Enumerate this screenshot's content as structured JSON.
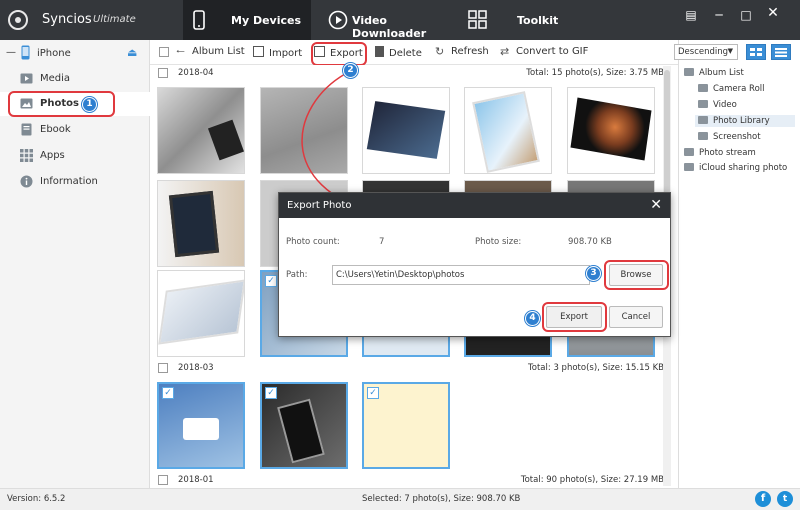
{
  "app": {
    "name": "Syncios",
    "edition": "Ultimate"
  },
  "nav": {
    "tabs": [
      {
        "label": "My Devices"
      },
      {
        "label": "Video Downloader"
      },
      {
        "label": "Toolkit"
      }
    ]
  },
  "device": {
    "name": "iPhone"
  },
  "sidebar": {
    "items": [
      {
        "label": "Media"
      },
      {
        "label": "Photos"
      },
      {
        "label": "Ebook"
      },
      {
        "label": "Apps"
      },
      {
        "label": "Information"
      }
    ]
  },
  "toolbar": {
    "album_list": "Album List",
    "import": "Import",
    "export": "Export",
    "delete": "Delete",
    "refresh": "Refresh",
    "convert": "Convert to GIF"
  },
  "sort": {
    "selected": "Descending"
  },
  "groups": [
    {
      "date": "2018-04",
      "summary": "Total: 15 photo(s), Size: 3.75 MB"
    },
    {
      "date": "2018-03",
      "summary": "Total: 3 photo(s), Size: 15.15 KB"
    },
    {
      "date": "2018-01",
      "summary": "Total: 90 photo(s), Size: 27.19 MB"
    }
  ],
  "albums": [
    {
      "label": "Album List"
    },
    {
      "label": "Camera Roll"
    },
    {
      "label": "Video"
    },
    {
      "label": "Photo Library"
    },
    {
      "label": "Screenshot"
    },
    {
      "label": "Photo stream"
    },
    {
      "label": "iCloud sharing photo"
    }
  ],
  "dialog": {
    "title": "Export Photo",
    "count_label": "Photo count:",
    "count_value": "7",
    "size_label": "Photo size:",
    "size_value": "908.70 KB",
    "path_label": "Path:",
    "path_value": "C:\\Users\\Yetin\\Desktop\\photos",
    "browse": "Browse",
    "export": "Export",
    "cancel": "Cancel"
  },
  "steps": [
    "1",
    "2",
    "3",
    "4"
  ],
  "status": {
    "version": "Version: 6.5.2",
    "selected": "Selected: 7 photo(s), Size: 908.70 KB"
  },
  "colors": {
    "titlebar": "#34373b",
    "accent": "#3a8ed6",
    "highlight": "#e0393e",
    "facebook": "#3b5998",
    "twitter": "#1da1f2"
  },
  "icons": {
    "close": "close-icon",
    "minimize": "minimize-icon",
    "maximize": "maximize-icon",
    "message": "message-icon",
    "facebook": "facebook-icon",
    "twitter": "twitter-icon"
  }
}
